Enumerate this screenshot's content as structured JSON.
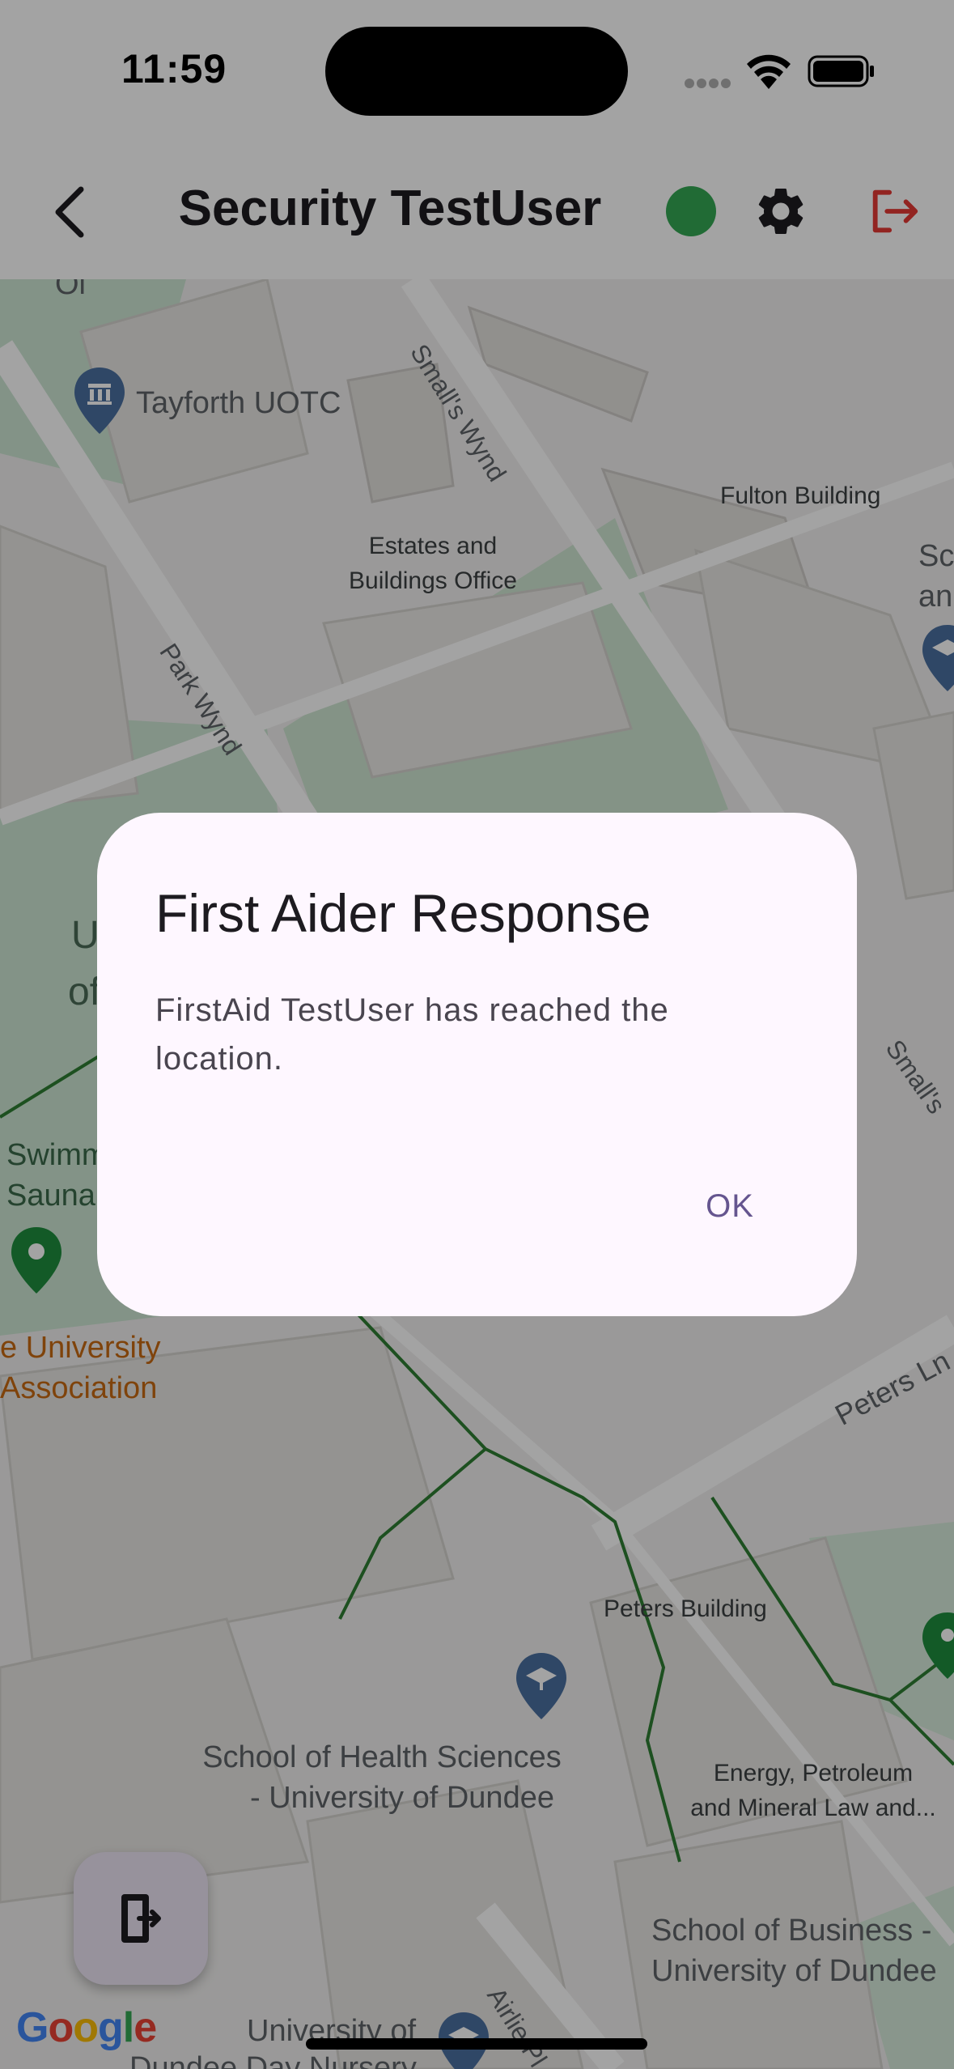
{
  "status_bar": {
    "time": "11:59"
  },
  "header": {
    "title": "Security TestUser",
    "status_color": "#34a853",
    "back_icon": "chevron-left-icon",
    "settings_icon": "gear-icon",
    "logout_icon": "logout-icon",
    "logout_color": "#e53935"
  },
  "map": {
    "labels": {
      "tayforth": "Tayforth UOTC",
      "smalls_wynd": "Small's Wynd",
      "fulton": "Fulton Building",
      "estates_1": "Estates and",
      "estates_2": "Buildings Office",
      "sc": "Sc",
      "an": "an",
      "park_wynd": "Park Wynd",
      "smalls_wynd_2": "Small's",
      "u": "U",
      "of": "of",
      "swimm": "Swimm",
      "sauna": "Sauna",
      "univ_assoc_1": "e University",
      "univ_assoc_2": "Association",
      "peters_ln": "Peters Ln",
      "peters_building": "Peters Building",
      "health_1": "School of Health Sciences",
      "health_2": "- University of Dundee",
      "energy_1": "Energy, Petroleum",
      "energy_2": "and Mineral Law and...",
      "business_1": "School of Business -",
      "business_2": "University of Dundee",
      "airlie": "Airlie Pl",
      "univ_of": "University of",
      "nursery": "Dundee Day Nursery",
      "ol": "Ol"
    }
  },
  "fab": {
    "icon": "exit-door-icon"
  },
  "google_logo": "Google",
  "dialog": {
    "title": "First Aider Response",
    "body": "FirstAid TestUser has reached the location.",
    "ok_label": "OK",
    "accent": "#65558f"
  }
}
